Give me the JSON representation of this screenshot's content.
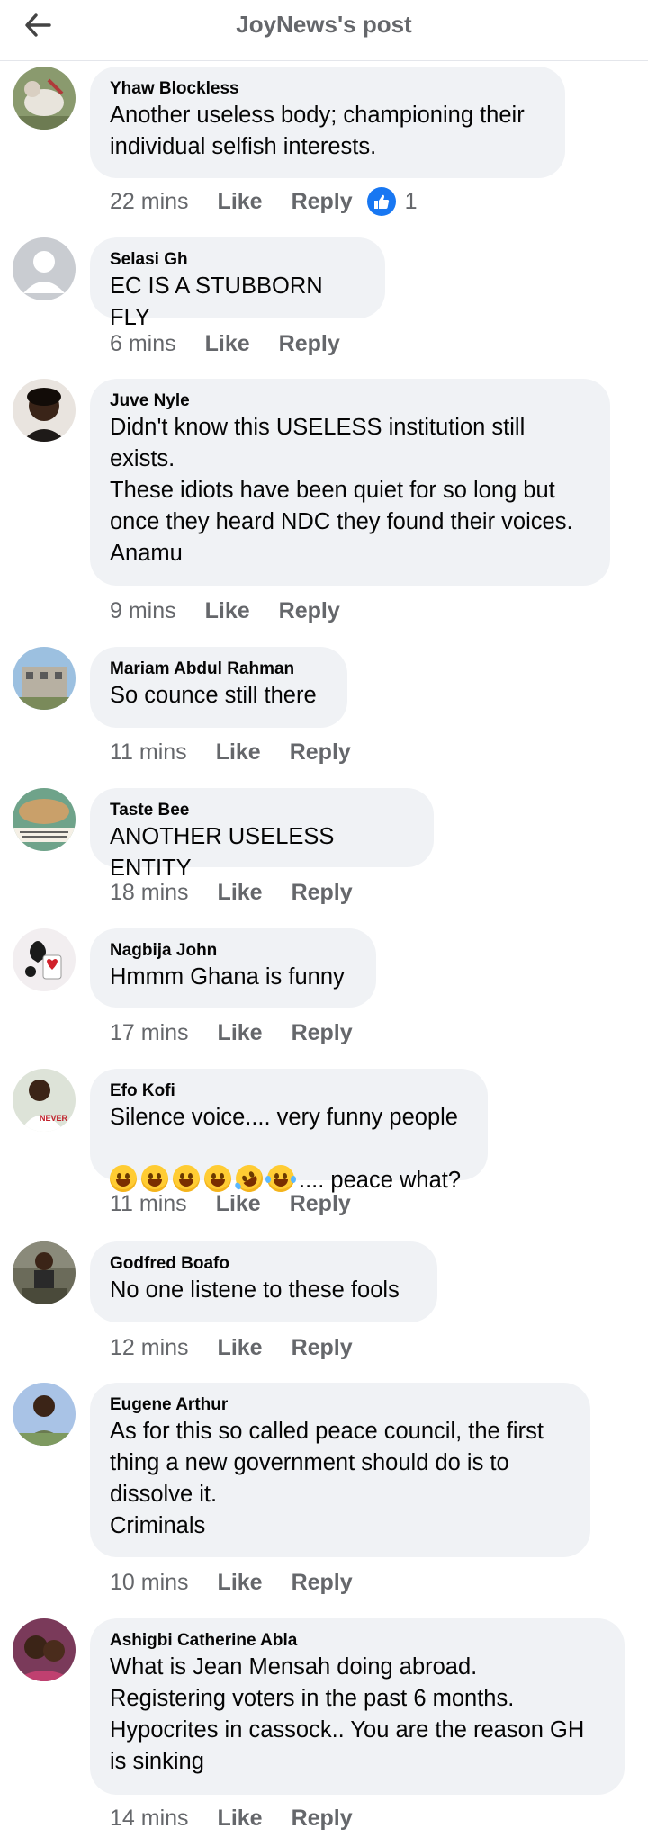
{
  "header": {
    "title": "JoyNews's post"
  },
  "comments": [
    {
      "author": "Yhaw Blockless",
      "text": "Another useless body; championing their\nindividual selfish interests.",
      "time": "22 mins",
      "like": "Like",
      "reply": "Reply",
      "reaction_count": "1",
      "reaction_icon": "thumbs-up-icon"
    },
    {
      "author": "Selasi Gh",
      "text": "EC IS A STUBBORN FLY",
      "time": "6 mins",
      "like": "Like",
      "reply": "Reply"
    },
    {
      "author": "Juve Nyle",
      "text": "Didn't know this USELESS institution still\nexists.\nThese idiots have been quiet for so long but\nonce they heard NDC they found their voices.\nAnamu",
      "time": "9 mins",
      "like": "Like",
      "reply": "Reply"
    },
    {
      "author": "Mariam Abdul Rahman",
      "text": "So counce still there",
      "time": "11 mins",
      "like": "Like",
      "reply": "Reply"
    },
    {
      "author": "Taste Bee",
      "text": "ANOTHER USELESS ENTITY",
      "time": "18 mins",
      "like": "Like",
      "reply": "Reply"
    },
    {
      "author": "Nagbija John",
      "text": "Hmmm Ghana is funny",
      "time": "17 mins",
      "like": "Like",
      "reply": "Reply"
    },
    {
      "author": "Efo Kofi",
      "text": "Silence voice.... very funny people",
      "text2": ".... peace what?",
      "emojis": [
        "grinning-squint-emoji",
        "grinning-emoji",
        "grinning-emoji",
        "sweat-smile-emoji",
        "rolling-laughing-emoji",
        "tears-of-joy-emoji"
      ],
      "time": "11 mins",
      "like": "Like",
      "reply": "Reply"
    },
    {
      "author": "Godfred Boafo",
      "text": "No one listene to these fools",
      "time": "12 mins",
      "like": "Like",
      "reply": "Reply"
    },
    {
      "author": "Eugene Arthur",
      "text": "As for this so called peace council, the first\nthing a new government should do is to\ndissolve it.\nCriminals",
      "time": "10 mins",
      "like": "Like",
      "reply": "Reply"
    },
    {
      "author": "Ashigbi Catherine Abla",
      "text": "What is Jean Mensah doing abroad.\nRegistering voters in the past 6 months.\nHypocrites in cassock.. You are the reason GH\nis sinking",
      "time": "14 mins",
      "like": "Like",
      "reply": "Reply"
    }
  ]
}
